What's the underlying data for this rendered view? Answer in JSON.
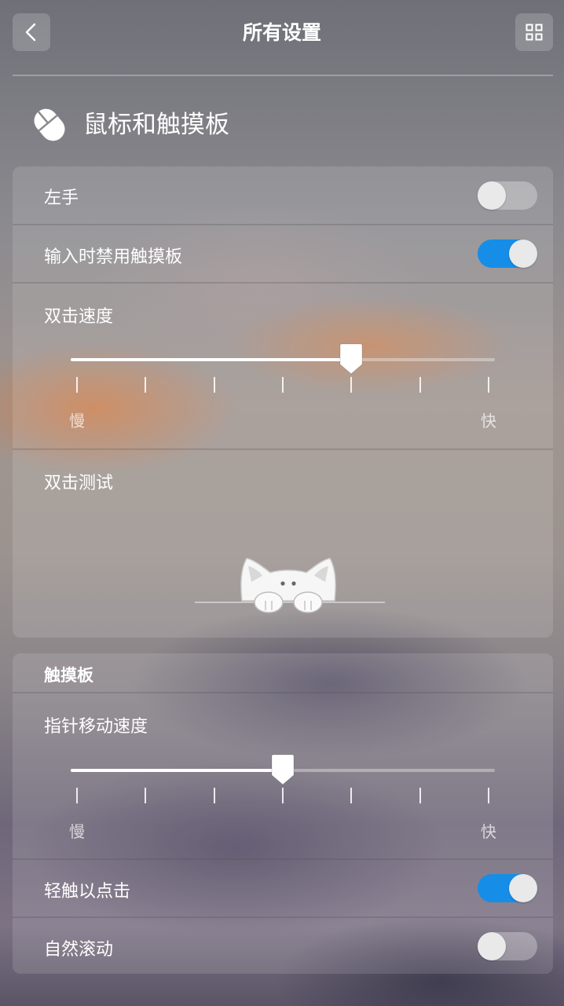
{
  "header": {
    "title": "所有设置",
    "back_icon": "chevron-left-icon",
    "grid_icon": "grid-icon"
  },
  "section": {
    "icon": "mouse-icon",
    "title": "鼠标和触摸板"
  },
  "mouse_panel": {
    "left_hand": {
      "label": "左手",
      "enabled": false
    },
    "disable_touchpad_while_typing": {
      "label": "输入时禁用触摸板",
      "enabled": true
    },
    "double_click_speed": {
      "label": "双击速度",
      "min_label": "慢",
      "max_label": "快",
      "steps": 7,
      "value_step": 5
    },
    "double_click_test": {
      "label": "双击测试",
      "image": "cat-icon"
    }
  },
  "touchpad_panel": {
    "group_label": "触摸板",
    "pointer_speed": {
      "label": "指针移动速度",
      "min_label": "慢",
      "max_label": "快",
      "steps": 7,
      "value_step": 4
    },
    "tap_to_click": {
      "label": "轻触以点击",
      "enabled": true
    },
    "natural_scrolling": {
      "label": "自然滚动",
      "enabled": false
    }
  },
  "colors": {
    "accent": "#168de7",
    "text": "#ffffff"
  }
}
